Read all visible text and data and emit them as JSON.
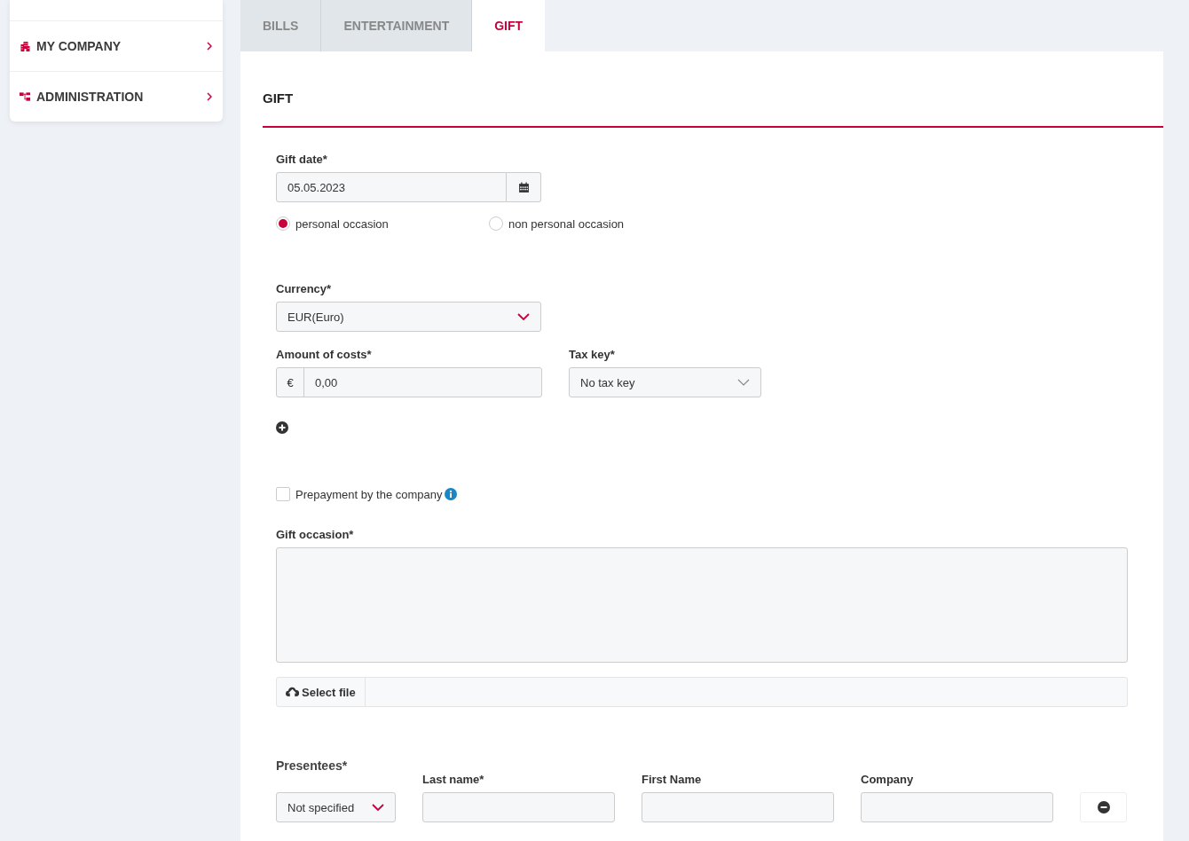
{
  "sidebar": {
    "items": [
      {
        "label": "MY COMPANY",
        "kind": "company"
      },
      {
        "label": "ADMINISTRATION",
        "kind": "admin"
      }
    ]
  },
  "tabs": [
    {
      "label": "BILLS",
      "selected": false
    },
    {
      "label": "ENTERTAINMENT",
      "selected": false
    },
    {
      "label": "GIFT",
      "selected": true
    }
  ],
  "form": {
    "title": "GIFT",
    "gift_date": {
      "label": "Gift date*",
      "value": "05.05.2023"
    },
    "occasion_type": [
      {
        "label": "personal occasion",
        "selected": true
      },
      {
        "label": "non personal occasion",
        "selected": false
      }
    ],
    "currency": {
      "label": "Currency*",
      "value": "EUR(Euro)"
    },
    "amount": {
      "label": "Amount of costs*",
      "prefix": "€",
      "value": "0,00"
    },
    "tax_key": {
      "label": "Tax key*",
      "value": "No tax key"
    },
    "prepayment": {
      "label": "Prepayment by the company",
      "checked": false
    },
    "gift_occasion": {
      "label": "Gift occasion*"
    },
    "file": {
      "button": "Select file"
    },
    "presentees": {
      "label": "Presentees*",
      "type": "Not specified",
      "columns": [
        "Last name*",
        "First Name",
        "Company"
      ]
    }
  }
}
